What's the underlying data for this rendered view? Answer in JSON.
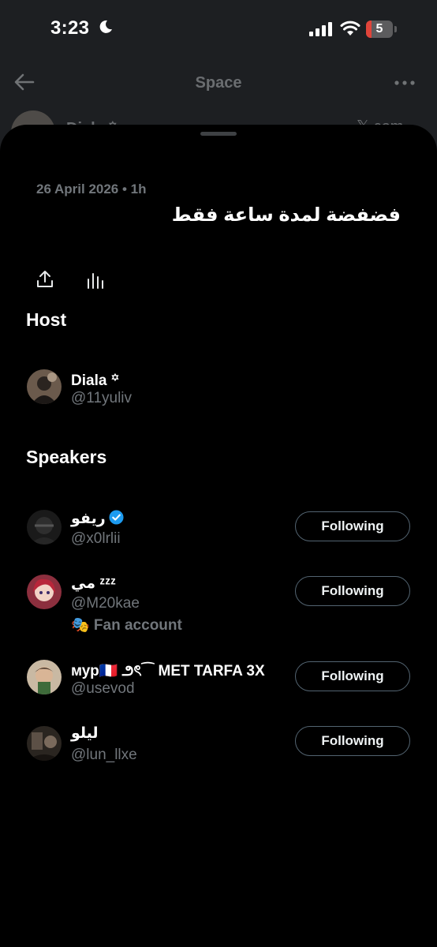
{
  "status_bar": {
    "time": "3:23",
    "battery_level": "5",
    "icons": [
      "moon-icon",
      "signal-icon",
      "wifi-icon",
      "battery-icon"
    ]
  },
  "background": {
    "title": "Space",
    "host_name": "Diala ꙳",
    "logo_text": "𝕏 com"
  },
  "sheet": {
    "date": "26 April 2026 • 1h",
    "space_title": "فضفضة لمدة ساعة فقط",
    "actions": [
      "share-icon",
      "stats-icon"
    ],
    "host_heading": "Host",
    "host": {
      "name": "Diala ꙳",
      "handle": "@11yuliv"
    },
    "speakers_heading": "Speakers",
    "speakers": [
      {
        "name": "ريفو",
        "handle": "@x0lrlii",
        "verified": true,
        "extra": "",
        "button": "Following"
      },
      {
        "name": "مي ᶻᶻᶻ",
        "handle": "@M20kae",
        "verified": false,
        "extra": "🎭 Fan account",
        "button": "Following"
      },
      {
        "name": "мур🇫🇷 ౨ৎ⁀ MET TARFA 3X",
        "handle": "@usevod",
        "verified": false,
        "extra": "",
        "button": "Following"
      },
      {
        "name": "ليلو",
        "handle": "@lun_llxe",
        "verified": false,
        "extra": "",
        "button": "Following"
      }
    ]
  },
  "colors": {
    "background": "#000000",
    "text_primary": "#e7e9ea",
    "text_secondary": "#71767b",
    "verified_blue": "#1d9bf0",
    "button_border": "#536471"
  }
}
